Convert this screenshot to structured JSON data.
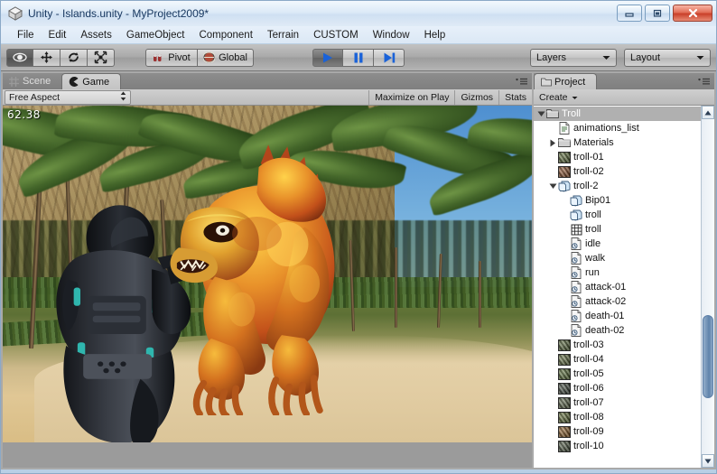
{
  "window": {
    "title": "Unity - Islands.unity - MyProject2009*",
    "app_icon": "unity-cube-icon",
    "controls": [
      {
        "name": "minimize-button",
        "glyph": "minimize-icon"
      },
      {
        "name": "maximize-button",
        "glyph": "maximize-icon"
      },
      {
        "name": "close-button",
        "glyph": "close-icon"
      }
    ]
  },
  "menubar": {
    "items": [
      {
        "label": "File"
      },
      {
        "label": "Edit"
      },
      {
        "label": "Assets"
      },
      {
        "label": "GameObject"
      },
      {
        "label": "Component"
      },
      {
        "label": "Terrain"
      },
      {
        "label": "CUSTOM"
      },
      {
        "label": "Window"
      },
      {
        "label": "Help"
      }
    ]
  },
  "toolbar": {
    "transform_tools": [
      {
        "name": "hand-tool",
        "icon": "eye-icon",
        "active": true
      },
      {
        "name": "move-tool",
        "icon": "move-arrows-icon",
        "active": false
      },
      {
        "name": "rotate-tool",
        "icon": "rotate-icon",
        "active": false
      },
      {
        "name": "scale-tool",
        "icon": "scale-icon",
        "active": false
      }
    ],
    "pivot_label": "Pivot",
    "pivot_icon": "pivot-icon",
    "global_label": "Global",
    "global_icon": "globe-icon",
    "playback": [
      {
        "name": "play-button",
        "icon": "play-icon",
        "active": true
      },
      {
        "name": "pause-button",
        "icon": "pause-icon",
        "active": false
      },
      {
        "name": "step-button",
        "icon": "step-icon",
        "active": false
      }
    ],
    "layers_label": "Layers",
    "layout_label": "Layout"
  },
  "game_panel": {
    "tabs": [
      {
        "label": "Scene",
        "icon": "grid-icon",
        "active": false
      },
      {
        "label": "Game",
        "icon": "gamepad-icon",
        "active": true
      }
    ],
    "aspect_label": "Free Aspect",
    "buttons": [
      {
        "label": "Maximize on Play"
      },
      {
        "label": "Gizmos"
      },
      {
        "label": "Stats"
      }
    ],
    "fps": "62.38",
    "scene": {
      "description": "tropical-island-game-view",
      "sky_color": "#4e8fd0",
      "sand_color": "#e0c795",
      "foliage_color": "#44662a",
      "troll_color": "#d9772a",
      "soldier_color": "#2b2d31",
      "soldier_accent": "#2fb6ae"
    }
  },
  "project_panel": {
    "tab_label": "Project",
    "tab_icon": "folder-icon",
    "menu_icon": "hamburger-menu-icon",
    "create_label": "Create",
    "tree": [
      {
        "label": "Troll",
        "icon": "folder",
        "indent": 0,
        "arrow": "expanded",
        "selected": true
      },
      {
        "label": "animations_list",
        "icon": "textfile",
        "indent": 1,
        "arrow": "none",
        "selected": false
      },
      {
        "label": "Materials",
        "icon": "folder",
        "indent": 1,
        "arrow": "collapsed",
        "selected": false
      },
      {
        "label": "troll-01",
        "icon": "texture",
        "indent": 1,
        "arrow": "none",
        "selected": false,
        "swatch": "#5a6b33"
      },
      {
        "label": "troll-02",
        "icon": "texture",
        "indent": 1,
        "arrow": "none",
        "selected": false,
        "swatch": "#8a4a22"
      },
      {
        "label": "troll-2",
        "icon": "prefab",
        "indent": 1,
        "arrow": "expanded",
        "selected": false
      },
      {
        "label": "Bip01",
        "icon": "prefab",
        "indent": 2,
        "arrow": "none",
        "selected": false
      },
      {
        "label": "troll",
        "icon": "prefab",
        "indent": 2,
        "arrow": "none",
        "selected": false
      },
      {
        "label": "troll",
        "icon": "mesh",
        "indent": 2,
        "arrow": "none",
        "selected": false
      },
      {
        "label": "idle",
        "icon": "animation",
        "indent": 2,
        "arrow": "none",
        "selected": false
      },
      {
        "label": "walk",
        "icon": "animation",
        "indent": 2,
        "arrow": "none",
        "selected": false
      },
      {
        "label": "run",
        "icon": "animation",
        "indent": 2,
        "arrow": "none",
        "selected": false
      },
      {
        "label": "attack-01",
        "icon": "animation",
        "indent": 2,
        "arrow": "none",
        "selected": false
      },
      {
        "label": "attack-02",
        "icon": "animation",
        "indent": 2,
        "arrow": "none",
        "selected": false
      },
      {
        "label": "death-01",
        "icon": "animation",
        "indent": 2,
        "arrow": "none",
        "selected": false
      },
      {
        "label": "death-02",
        "icon": "animation",
        "indent": 2,
        "arrow": "none",
        "selected": false
      },
      {
        "label": "troll-03",
        "icon": "texture",
        "indent": 1,
        "arrow": "none",
        "selected": false,
        "swatch": "#4f6130"
      },
      {
        "label": "troll-04",
        "icon": "texture",
        "indent": 1,
        "arrow": "none",
        "selected": false,
        "swatch": "#5e6b38"
      },
      {
        "label": "troll-05",
        "icon": "texture",
        "indent": 1,
        "arrow": "none",
        "selected": false,
        "swatch": "#51682c"
      },
      {
        "label": "troll-06",
        "icon": "texture",
        "indent": 1,
        "arrow": "none",
        "selected": false,
        "swatch": "#3a4436"
      },
      {
        "label": "troll-07",
        "icon": "texture",
        "indent": 1,
        "arrow": "none",
        "selected": false,
        "swatch": "#556040"
      },
      {
        "label": "troll-08",
        "icon": "texture",
        "indent": 1,
        "arrow": "none",
        "selected": false,
        "swatch": "#5c6a2e"
      },
      {
        "label": "troll-09",
        "icon": "texture",
        "indent": 1,
        "arrow": "none",
        "selected": false,
        "swatch": "#8d5a1f"
      },
      {
        "label": "troll-10",
        "icon": "texture",
        "indent": 1,
        "arrow": "none",
        "selected": false,
        "swatch": "#47543c"
      }
    ],
    "scrollbar": {
      "up_icon": "scroll-up-arrow-icon",
      "down_icon": "scroll-down-arrow-icon"
    }
  }
}
